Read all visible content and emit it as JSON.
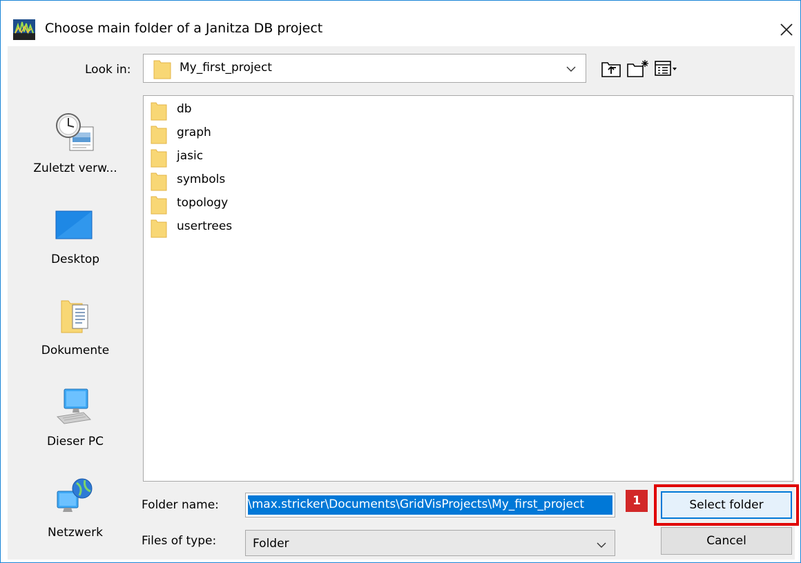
{
  "window": {
    "title": "Choose main folder of a Janitza DB project",
    "app_icon": "gridvis-app-icon",
    "close_icon": "close-icon"
  },
  "toolbar": {
    "look_in_label": "Look in:",
    "look_in_value": "My_first_project",
    "buttons": [
      "up-one-level-icon",
      "create-new-folder-icon",
      "view-menu-icon"
    ]
  },
  "places": [
    {
      "label": "Zuletzt verw...",
      "icon": "recent-items-icon"
    },
    {
      "label": "Desktop",
      "icon": "desktop-icon"
    },
    {
      "label": "Dokumente",
      "icon": "documents-icon"
    },
    {
      "label": "Dieser PC",
      "icon": "computer-icon"
    },
    {
      "label": "Netzwerk",
      "icon": "network-icon"
    }
  ],
  "folders": [
    "db",
    "graph",
    "jasic",
    "symbols",
    "topology",
    "usertrees"
  ],
  "folder_name": {
    "label": "Folder name:",
    "value": "\\max.stricker\\Documents\\GridVisProjects\\My_first_project"
  },
  "file_type": {
    "label": "Files of type:",
    "value": "Folder"
  },
  "actions": {
    "select_label": "Select folder",
    "cancel_label": "Cancel",
    "badge": "1"
  },
  "colors": {
    "accent": "#0078d7",
    "highlight": "#e00000",
    "badge": "#d22828",
    "folder": "#f8d775"
  }
}
